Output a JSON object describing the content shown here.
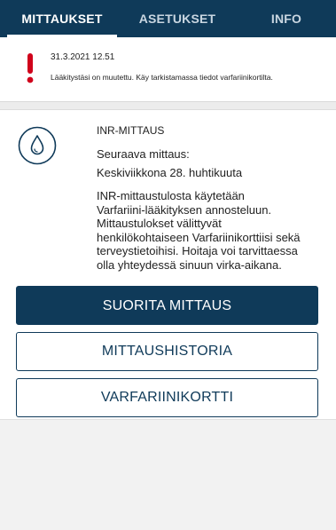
{
  "tabs": [
    {
      "label": "MITTAUKSET",
      "active": true
    },
    {
      "label": "ASETUKSET",
      "active": false
    },
    {
      "label": "INFO",
      "active": false
    }
  ],
  "notice": {
    "icon": "exclamation-icon",
    "color": "#d0021b",
    "date": "31.3.2021 12.51",
    "text": "Lääkitystäsi on muutettu. Käy tarkistamassa tiedot varfariinikortilta."
  },
  "measurement": {
    "icon": "drop-icon",
    "title": "INR-MITTAUS",
    "next_label": "Seuraava mittaus:",
    "next_date": "Keskiviikkona 28. huhtikuuta",
    "description": [
      "INR-mittaustulosta käytetään",
      "Varfariini-lääkityksen annosteluun.",
      "Mittaustulokset välittyvät",
      "henkilökohtaiseen Varfariinikorttiisi sekä",
      "terveystietoihisi. Hoitaja voi tarvittaessa",
      "olla yhteydessä sinuun virka-aikana."
    ]
  },
  "buttons": {
    "perform": "SUORITA MITTAUS",
    "history": "MITTAUSHISTORIA",
    "card": "VARFARIINIKORTTI"
  },
  "colors": {
    "primary": "#0f3a59",
    "alert": "#d0021b"
  }
}
